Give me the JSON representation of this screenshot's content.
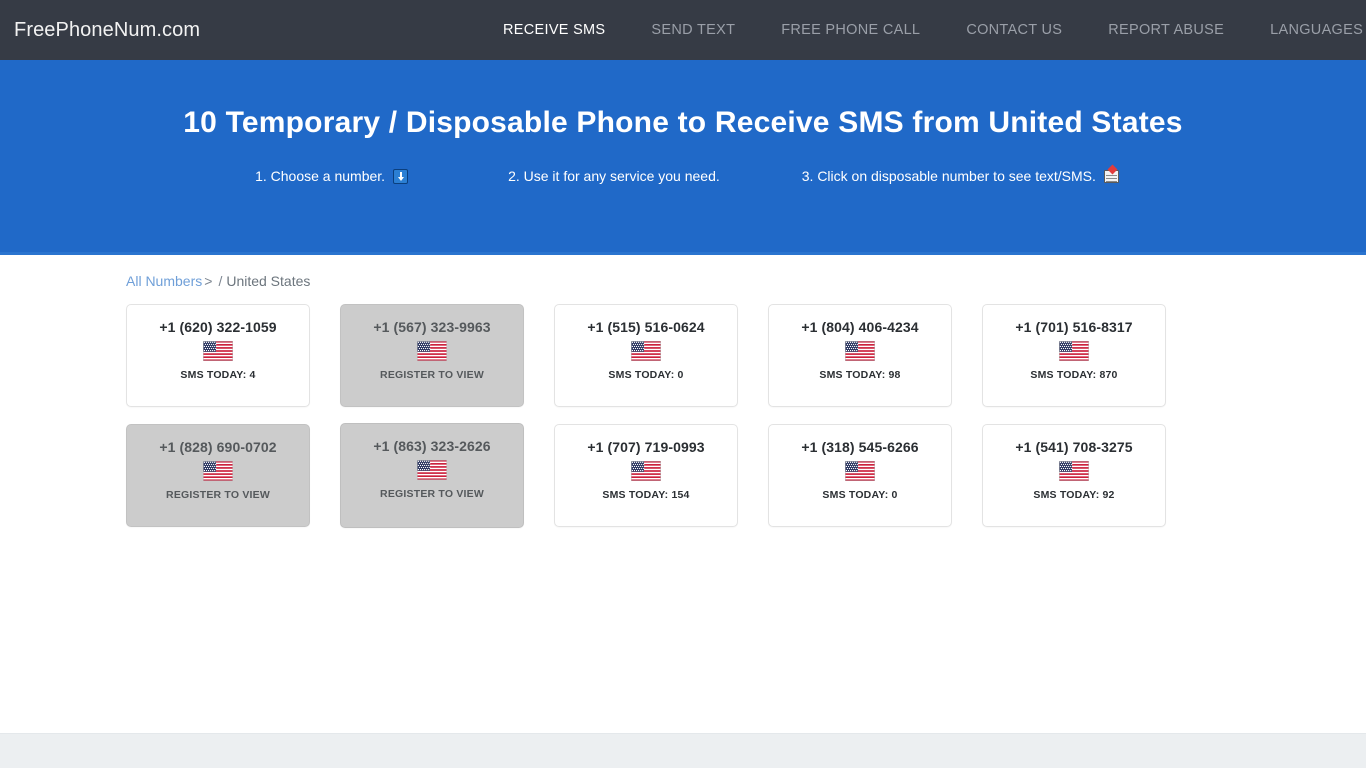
{
  "navbar": {
    "brand": "FreePhoneNum.com",
    "links": [
      {
        "label": "RECEIVE SMS",
        "active": true
      },
      {
        "label": "SEND TEXT",
        "active": false
      },
      {
        "label": "FREE PHONE CALL",
        "active": false
      },
      {
        "label": "CONTACT US",
        "active": false
      },
      {
        "label": "REPORT ABUSE",
        "active": false
      },
      {
        "label": "LANGUAGES",
        "active": false,
        "caret": true
      }
    ],
    "bg_color": "#363b45",
    "active_color": "#ffffff",
    "inactive_color": "#9a9fa8"
  },
  "hero": {
    "title": "10 Temporary / Disposable Phone to Receive SMS from United States",
    "bg_color": "#2069c8",
    "steps": [
      {
        "text": "1. Choose a number.",
        "icon": "down-arrow-icon"
      },
      {
        "text": "2. Use it for any service you need.",
        "icon": ""
      },
      {
        "text": "3. Click on disposable number to see text/SMS.",
        "icon": "incoming-envelope-icon"
      }
    ]
  },
  "breadcrumb": {
    "link_label": "All Numbers",
    "separator": ">",
    "slash": "/",
    "current": "United States"
  },
  "numbers": [
    {
      "number": "+1 (620) 322-1059",
      "meta": "SMS TODAY: 4",
      "locked": false,
      "hovered": false
    },
    {
      "number": "+1 (567) 323-9963",
      "meta": "REGISTER TO VIEW",
      "locked": true,
      "hovered": false
    },
    {
      "number": "+1 (515) 516-0624",
      "meta": "SMS TODAY: 0",
      "locked": false,
      "hovered": false
    },
    {
      "number": "+1 (804) 406-4234",
      "meta": "SMS TODAY: 98",
      "locked": false,
      "hovered": false
    },
    {
      "number": "+1 (701) 516-8317",
      "meta": "SMS TODAY: 870",
      "locked": false,
      "hovered": false
    },
    {
      "number": "+1 (828) 690-0702",
      "meta": "REGISTER TO VIEW",
      "locked": true,
      "hovered": false
    },
    {
      "number": "+1 (863) 323-2626",
      "meta": "REGISTER TO VIEW",
      "locked": true,
      "hovered": true
    },
    {
      "number": "+1 (707) 719-0993",
      "meta": "SMS TODAY: 154",
      "locked": false,
      "hovered": false
    },
    {
      "number": "+1 (318) 545-6266",
      "meta": "SMS TODAY: 0",
      "locked": false,
      "hovered": false
    },
    {
      "number": "+1 (541) 708-3275",
      "meta": "SMS TODAY: 92",
      "locked": false,
      "hovered": false
    }
  ],
  "flag": {
    "name": "united-states-flag-icon",
    "alt": "United States"
  }
}
